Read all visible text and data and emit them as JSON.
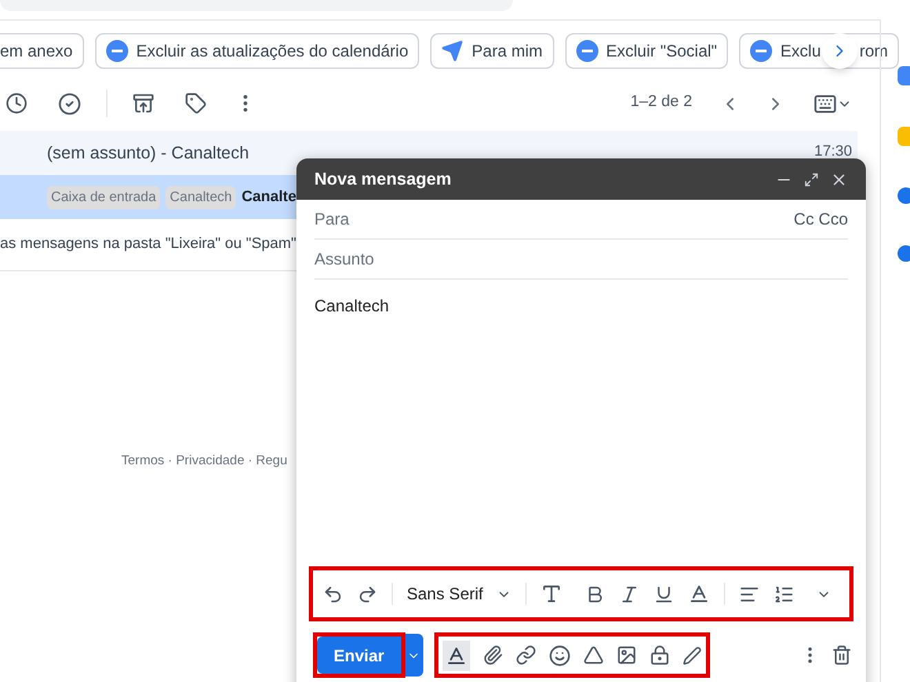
{
  "chips": [
    {
      "kind": "plain",
      "label": "em anexo"
    },
    {
      "kind": "exclude",
      "label": "Excluir as atualizações do calendário"
    },
    {
      "kind": "send",
      "label": "Para mim"
    },
    {
      "kind": "exclude",
      "label": "Excluir \"Social\""
    },
    {
      "kind": "exclude",
      "label": "Exclu",
      "label_tail": "rom"
    }
  ],
  "pager": "1–2 de 2",
  "emails": [
    {
      "subject": "(sem assunto) - Canaltech",
      "time": "17:30",
      "selected": false
    },
    {
      "selected": true,
      "labels": [
        "Caixa de entrada",
        "Canaltech"
      ],
      "sender": "Canalte"
    }
  ],
  "notice": "as mensagens na pasta \"Lixeira\" ou \"Spam\"",
  "footer": "Termos · Privacidade · Regu",
  "compose": {
    "title": "Nova mensagem",
    "to_placeholder": "Para",
    "cc": "Cc Cco",
    "subject_placeholder": "Assunto",
    "body": "Canaltech",
    "font": "Sans Serif",
    "send": "Enviar",
    "highlights": {
      "formatting": true,
      "send": true,
      "insert": true
    }
  }
}
